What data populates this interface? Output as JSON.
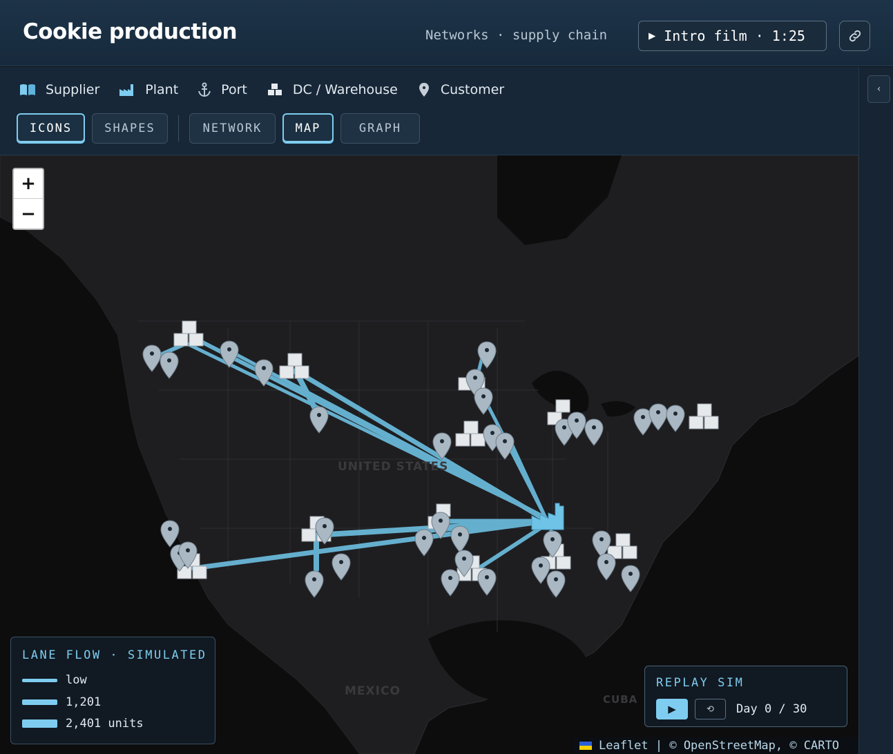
{
  "header": {
    "title": "Cookie production",
    "subtitle": "Networks · supply chain",
    "intro_button": "Intro film · 1:25"
  },
  "legend": {
    "items": [
      {
        "label": "Supplier",
        "icon": "book-icon"
      },
      {
        "label": "Plant",
        "icon": "factory-icon"
      },
      {
        "label": "Port",
        "icon": "anchor-icon"
      },
      {
        "label": "DC / Warehouse",
        "icon": "boxes-icon"
      },
      {
        "label": "Customer",
        "icon": "map-pin-icon"
      }
    ]
  },
  "view_toggles": {
    "style": [
      {
        "label": "ICONS",
        "active": true
      },
      {
        "label": "SHAPES",
        "active": false
      }
    ],
    "layout": [
      {
        "label": "NETWORK",
        "active": false
      },
      {
        "label": "MAP",
        "active": true
      },
      {
        "label": "GRAPH",
        "active": false
      }
    ]
  },
  "map": {
    "labels": {
      "us": "UNITED STATES",
      "mexico": "MEXICO",
      "cuba": "CUBA"
    },
    "zoom_in": "+",
    "zoom_out": "−"
  },
  "flow_legend": {
    "title": "LANE FLOW · SIMULATED",
    "rows": [
      {
        "label": "low"
      },
      {
        "label": "1,201"
      },
      {
        "label": "2,401 units"
      }
    ]
  },
  "replay": {
    "title": "REPLAY SIM",
    "play": "▶",
    "reset": "⟲",
    "day_label": "Day 0 / 30"
  },
  "attribution": "Leaflet | © OpenStreetMap, © CARTO",
  "colors": {
    "accent": "#7ecdf0",
    "header_bg": "#1d3348",
    "map_bg": "#0d0d0e"
  }
}
